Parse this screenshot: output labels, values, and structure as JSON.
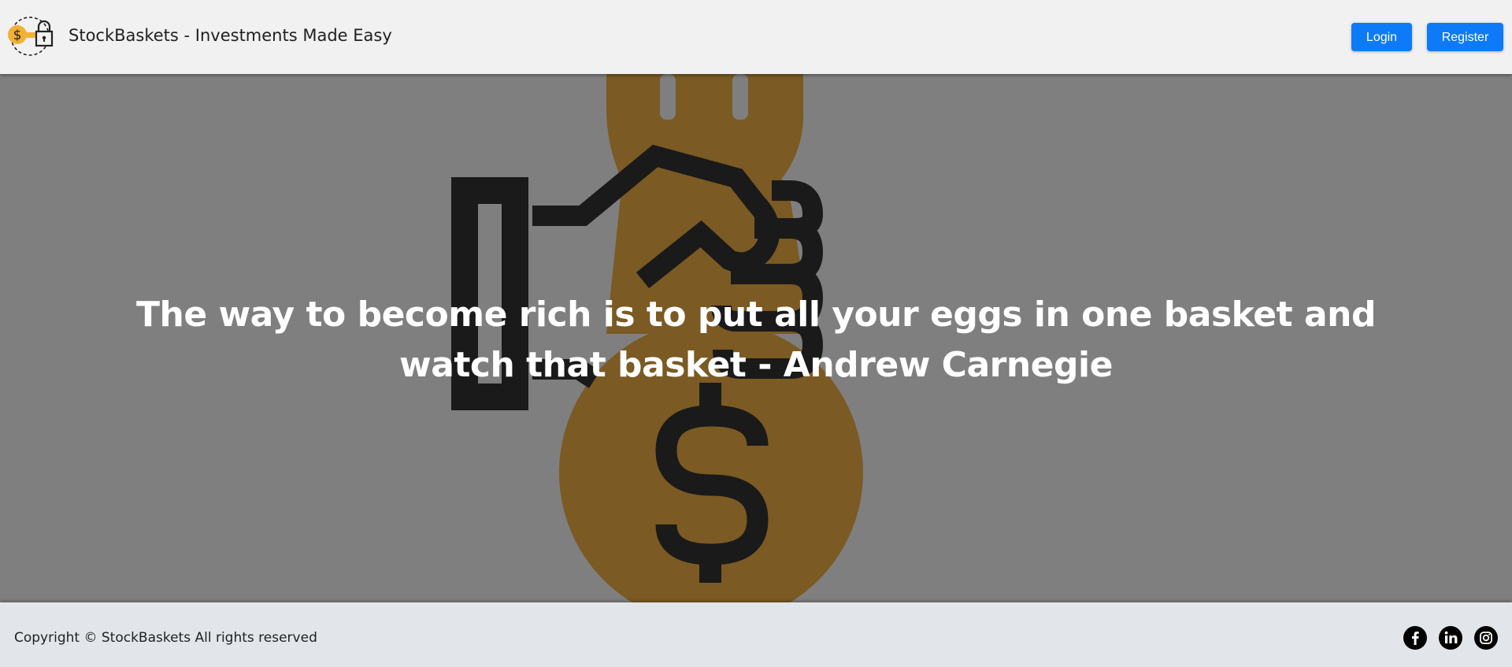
{
  "header": {
    "title": "StockBaskets - Investments Made Easy",
    "login_label": "Login",
    "register_label": "Register"
  },
  "hero": {
    "quote_line1": "The way to become rich is to put all your eggs in one basket and",
    "quote_line2": "watch that basket - Andrew Carnegie",
    "background_color": "#7f7f7f",
    "money_bag_color": "#7b5a23"
  },
  "footer": {
    "copyright": "Copyright © StockBaskets All rights reserved",
    "social_icons": [
      "facebook-icon",
      "linkedin-icon",
      "instagram-icon"
    ]
  },
  "colors": {
    "accent": "#0d7bf7",
    "navbar_bg": "#f1f1f1",
    "footer_bg": "#e2e6ea"
  }
}
